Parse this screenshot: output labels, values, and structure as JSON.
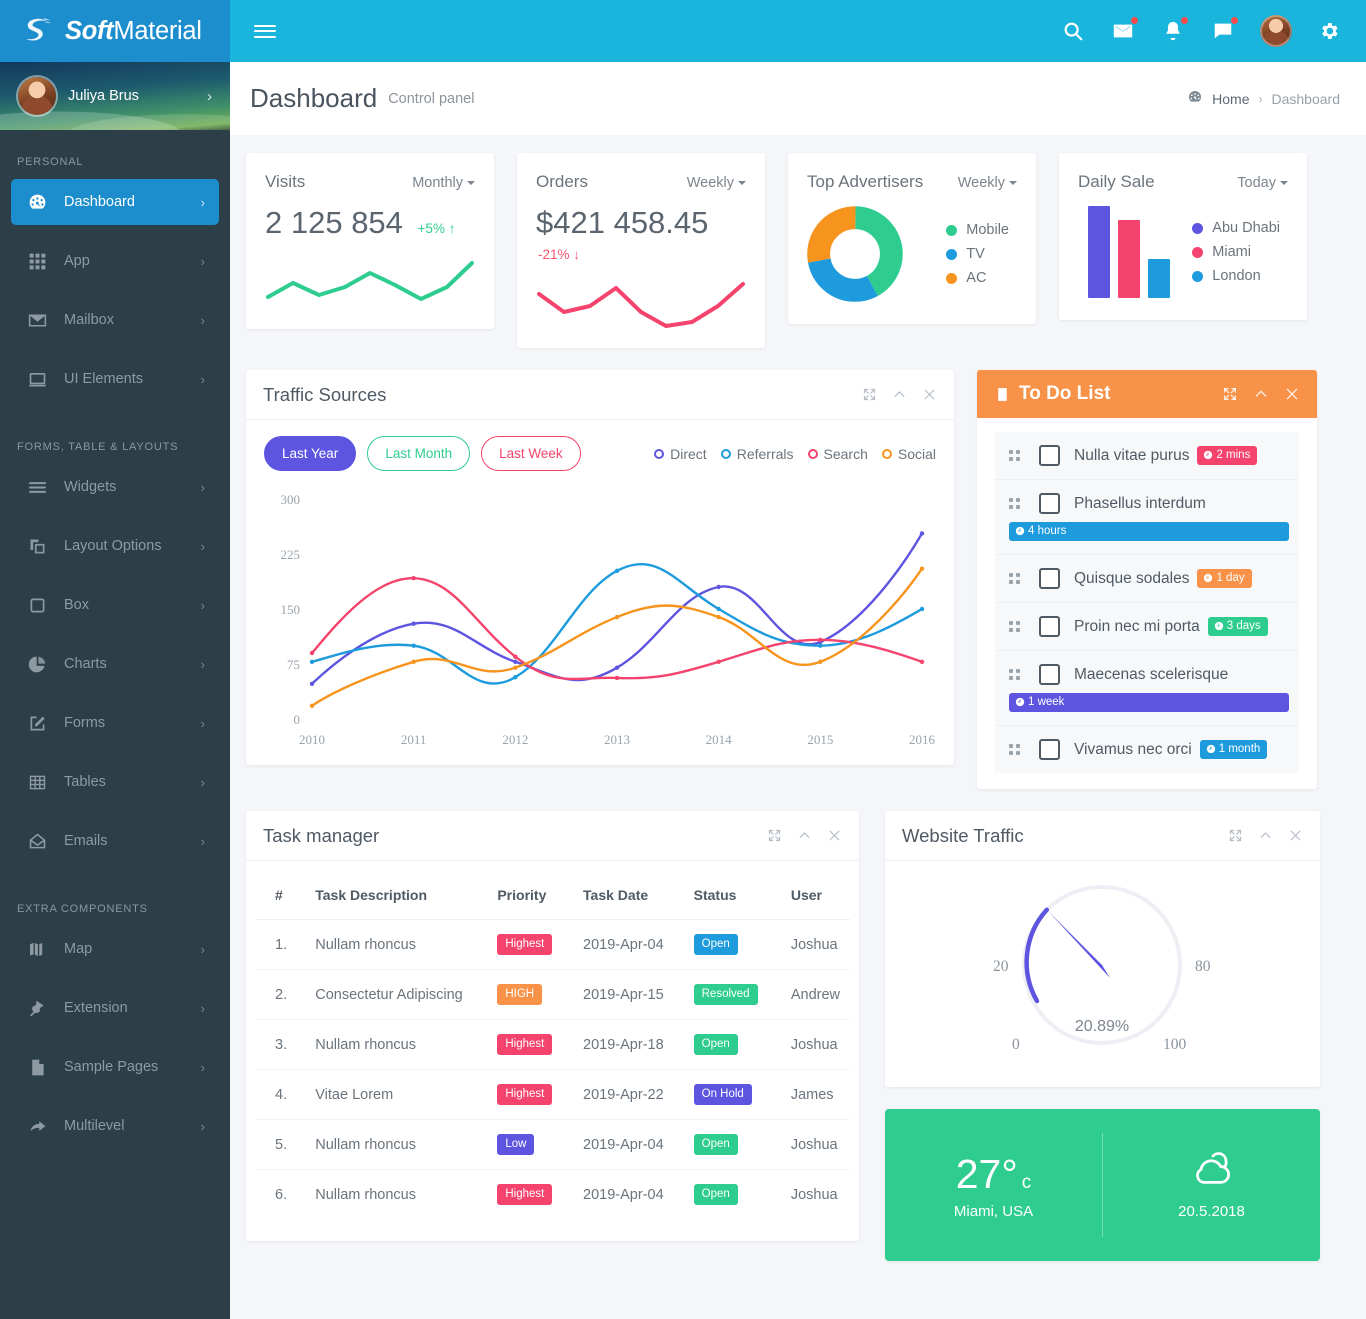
{
  "brand": {
    "bold": "Soft",
    "light": "Material",
    "logo_icon": "soft-material-logo-icon"
  },
  "navbar": {
    "menu_toggle_icon": "hamburger-icon",
    "icons": [
      {
        "name": "search-icon",
        "dot": false
      },
      {
        "name": "mail-icon",
        "dot": true
      },
      {
        "name": "bell-icon",
        "dot": true
      },
      {
        "name": "chat-icon",
        "dot": true
      }
    ],
    "avatar_name": "user-avatar",
    "settings_icon": "gear-icon"
  },
  "sidebar": {
    "profile": {
      "name": "Juliya Brus",
      "arrow": "›"
    },
    "sections": [
      {
        "heading": "PERSONAL",
        "items": [
          {
            "label": "Dashboard",
            "icon": "dashboard-gauge-icon",
            "active": true
          },
          {
            "label": "App",
            "icon": "grid-apps-icon",
            "active": false
          },
          {
            "label": "Mailbox",
            "icon": "envelope-icon",
            "active": false
          },
          {
            "label": "UI Elements",
            "icon": "monitor-icon",
            "active": false
          }
        ]
      },
      {
        "heading": "FORMS, TABLE & LAYOUTS",
        "items": [
          {
            "label": "Widgets",
            "icon": "list-lines-icon",
            "active": false
          },
          {
            "label": "Layout Options",
            "icon": "layers-icon",
            "active": false
          },
          {
            "label": "Box",
            "icon": "square-icon",
            "active": false
          },
          {
            "label": "Charts",
            "icon": "pie-chart-icon",
            "active": false
          },
          {
            "label": "Forms",
            "icon": "edit-pencil-icon",
            "active": false
          },
          {
            "label": "Tables",
            "icon": "table-grid-icon",
            "active": false
          },
          {
            "label": "Emails",
            "icon": "open-envelope-icon",
            "active": false
          }
        ]
      },
      {
        "heading": "EXTRA COMPONENTS",
        "items": [
          {
            "label": "Map",
            "icon": "map-icon",
            "active": false
          },
          {
            "label": "Extension",
            "icon": "plug-icon",
            "active": false
          },
          {
            "label": "Sample Pages",
            "icon": "file-icon",
            "active": false
          },
          {
            "label": "Multilevel",
            "icon": "arrow-forward-icon",
            "active": false
          }
        ]
      }
    ]
  },
  "page": {
    "title": "Dashboard",
    "subtitle": "Control panel",
    "breadcrumb": {
      "home_icon": "dashboard-gauge-icon",
      "home": "Home",
      "sep": "›",
      "current": "Dashboard"
    }
  },
  "stats": {
    "visits": {
      "name": "Visits",
      "period": "Monthly",
      "value": "2 125 854",
      "delta": "+5%",
      "delta_arrow": "↑",
      "direction": "up",
      "color": "#2ecc8f"
    },
    "orders": {
      "name": "Orders",
      "period": "Weekly",
      "value": "$421 458.45",
      "delta": "-21%",
      "delta_arrow": "↓",
      "direction": "down",
      "color": "#f8556d"
    },
    "advertisers": {
      "name": "Top Advertisers",
      "period": "Weekly",
      "legend": [
        {
          "label": "Mobile",
          "color": "#2ecc8f"
        },
        {
          "label": "TV",
          "color": "#1d9bdd"
        },
        {
          "label": "AC",
          "color": "#f7941e"
        }
      ]
    },
    "daily_sale": {
      "name": "Daily Sale",
      "period": "Today",
      "legend": [
        {
          "label": "Abu Dhabi",
          "color": "#5d55e0"
        },
        {
          "label": "Miami",
          "color": "#f4436c"
        },
        {
          "label": "London",
          "color": "#1d9bdd"
        }
      ]
    }
  },
  "traffic": {
    "title": "Traffic Sources",
    "tools": [
      "expand-icon",
      "collapse-icon",
      "close-icon"
    ],
    "buttons": [
      {
        "label": "Last Year",
        "style": "fill"
      },
      {
        "label": "Last Month",
        "style": "green"
      },
      {
        "label": "Last Week",
        "style": "pink"
      }
    ]
  },
  "todo": {
    "title": "To Do List",
    "header_icon": "clipboard-list-icon",
    "tools": [
      "expand-icon",
      "collapse-icon",
      "close-icon"
    ],
    "items": [
      {
        "label": "Nulla vitae purus",
        "badge": "2 mins",
        "color": "#f4436c",
        "wrap": false
      },
      {
        "label": "Phasellus interdum",
        "badge": "4 hours",
        "color": "#1d9bdd",
        "wrap": true
      },
      {
        "label": "Quisque sodales",
        "badge": "1 day",
        "color": "#f79248",
        "wrap": false
      },
      {
        "label": "Proin nec mi porta",
        "badge": "3 days",
        "color": "#2ecc8f",
        "wrap": false
      },
      {
        "label": "Maecenas scelerisque",
        "badge": "1 week",
        "color": "#5d55e0",
        "wrap": true
      },
      {
        "label": "Vivamus nec orci",
        "badge": "1 month",
        "color": "#1d9bdd",
        "wrap": false
      }
    ]
  },
  "task_manager": {
    "title": "Task manager",
    "tools": [
      "expand-icon",
      "collapse-icon",
      "close-icon"
    ],
    "columns": [
      "#",
      "Task Description",
      "Priority",
      "Task Date",
      "Status",
      "User"
    ],
    "rows": [
      {
        "num": "1.",
        "desc": "Nullam rhoncus",
        "priority": "Highest",
        "priority_color": "#f4436c",
        "date": "2019-Apr-04",
        "status": "Open",
        "status_color": "#1d9bdd",
        "user": "Joshua"
      },
      {
        "num": "2.",
        "desc": "Consectetur Adipiscing",
        "priority": "HIGH",
        "priority_color": "#f79248",
        "date": "2019-Apr-15",
        "status": "Resolved",
        "status_color": "#2ecc8f",
        "user": "Andrew"
      },
      {
        "num": "3.",
        "desc": "Nullam rhoncus",
        "priority": "Highest",
        "priority_color": "#f4436c",
        "date": "2019-Apr-18",
        "status": "Open",
        "status_color": "#2ecc8f",
        "user": "Joshua"
      },
      {
        "num": "4.",
        "desc": "Vitae Lorem",
        "priority": "Highest",
        "priority_color": "#f4436c",
        "date": "2019-Apr-22",
        "status": "On Hold",
        "status_color": "#5d55e0",
        "user": "James"
      },
      {
        "num": "5.",
        "desc": "Nullam rhoncus",
        "priority": "Low",
        "priority_color": "#5d55e0",
        "date": "2019-Apr-04",
        "status": "Open",
        "status_color": "#2ecc8f",
        "user": "Joshua"
      },
      {
        "num": "6.",
        "desc": "Nullam rhoncus",
        "priority": "Highest",
        "priority_color": "#f4436c",
        "date": "2019-Apr-04",
        "status": "Open",
        "status_color": "#2ecc8f",
        "user": "Joshua"
      }
    ]
  },
  "website_traffic": {
    "title": "Website Traffic",
    "tools": [
      "expand-icon",
      "collapse-icon",
      "close-icon"
    ]
  },
  "weather": {
    "temp": "27°",
    "unit": "c",
    "city": "Miami, USA",
    "date": "20.5.2018",
    "icon": "cloud-icon",
    "bg_color": "#2ecc8f"
  },
  "chart_data": [
    {
      "type": "line",
      "title": "Traffic Sources",
      "x": [
        "2010",
        "2011",
        "2012",
        "2013",
        "2014",
        "2015",
        "2016"
      ],
      "ylim": [
        0,
        300
      ],
      "yticks": [
        0,
        75,
        150,
        225,
        300
      ],
      "xlabel": "",
      "ylabel": "",
      "grid": false,
      "legend_position": "top-right",
      "series": [
        {
          "name": "Direct",
          "color": "#5d55e0",
          "values": [
            48,
            130,
            78,
            70,
            180,
            105,
            253
          ]
        },
        {
          "name": "Referrals",
          "color": "#1d9bdd",
          "values": [
            78,
            100,
            57,
            202,
            150,
            100,
            150
          ]
        },
        {
          "name": "Search",
          "color": "#f4436c",
          "values": [
            90,
            192,
            85,
            56,
            78,
            108,
            78
          ]
        },
        {
          "name": "Social",
          "color": "#f7941e",
          "values": [
            18,
            78,
            70,
            139,
            139,
            78,
            205
          ]
        }
      ]
    },
    {
      "type": "line",
      "title": "Visits sparkline",
      "ylim": [
        0,
        100
      ],
      "values": [
        30,
        55,
        36,
        44,
        66,
        48,
        34,
        52,
        88
      ],
      "color": "#2ecc8f"
    },
    {
      "type": "line",
      "title": "Orders sparkline",
      "ylim": [
        0,
        100
      ],
      "values": [
        62,
        44,
        50,
        70,
        44,
        22,
        26,
        44,
        74
      ],
      "color": "#f4436c"
    },
    {
      "type": "pie",
      "title": "Top Advertisers",
      "labels": [
        "Mobile",
        "TV",
        "AC"
      ],
      "values": [
        42,
        30,
        28
      ],
      "colors": [
        "#2ecc8f",
        "#1d9bdd",
        "#f7941e"
      ],
      "donut": true
    },
    {
      "type": "bar",
      "title": "Daily Sale",
      "categories": [
        "Abu Dhabi",
        "Miami",
        "London"
      ],
      "values": [
        100,
        85,
        42
      ],
      "colors": [
        "#5d55e0",
        "#f4436c",
        "#1d9bdd"
      ],
      "ylim": [
        0,
        100
      ]
    },
    {
      "type": "gauge",
      "title": "Website Traffic",
      "value": 20.89,
      "value_label": "20.89%",
      "ylim": [
        0,
        100
      ],
      "ticks": [
        0,
        20,
        80,
        100
      ],
      "color": "#5d55e0",
      "track_color": "#eeeff4"
    }
  ]
}
